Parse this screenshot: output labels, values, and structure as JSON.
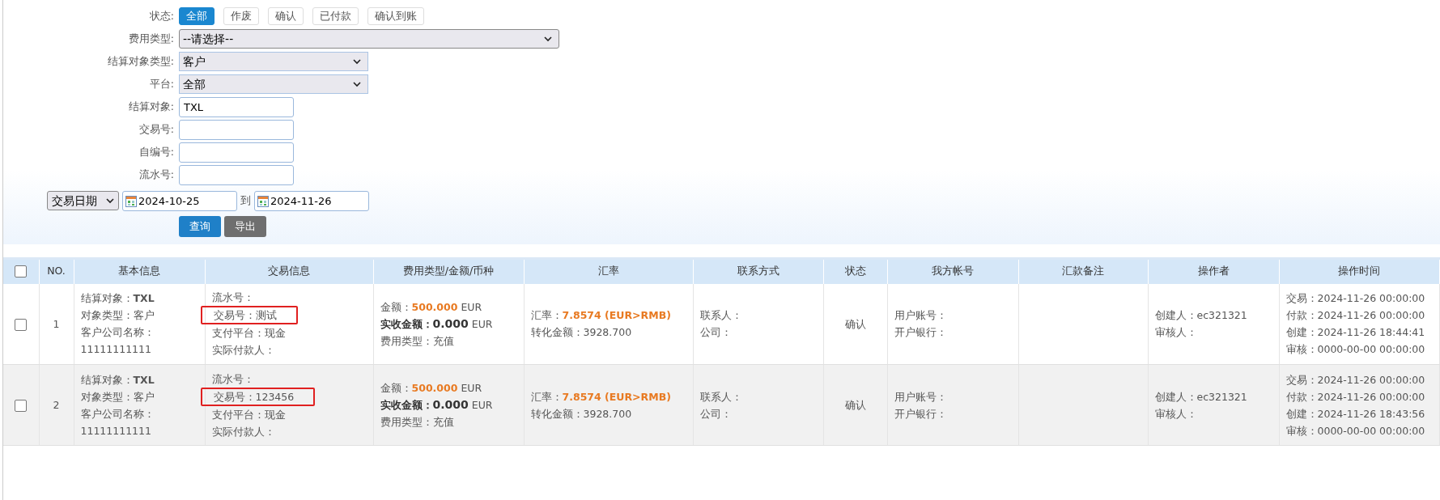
{
  "filters": {
    "status": {
      "label": "状态:",
      "options": [
        {
          "label": "全部",
          "selected": true
        },
        {
          "label": "作废",
          "selected": false
        },
        {
          "label": "确认",
          "selected": false
        },
        {
          "label": "已付款",
          "selected": false
        },
        {
          "label": "确认到账",
          "selected": false
        }
      ]
    },
    "fields": [
      {
        "label": "费用类型:",
        "kind": "wide-select",
        "value": "--请选择--"
      },
      {
        "label": "结算对象类型:",
        "kind": "select",
        "value": "客户"
      },
      {
        "label": "平台:",
        "kind": "select",
        "value": "全部"
      },
      {
        "label": "结算对象:",
        "kind": "input",
        "value": "TXL"
      },
      {
        "label": "交易号:",
        "kind": "input"
      },
      {
        "label": "自编号:",
        "kind": "input"
      },
      {
        "label": "流水号:",
        "kind": "input"
      }
    ],
    "date_range": {
      "type": "交易日期",
      "from": "2024-10-25",
      "separator": "到",
      "to": "2024-11-26"
    },
    "buttons": [
      {
        "label": "查询",
        "kind": "primary"
      },
      {
        "label": "导出",
        "kind": "secondary"
      }
    ]
  },
  "table": {
    "all_checked": false,
    "columns": [
      "NO.",
      "基本信息",
      "交易信息",
      "费用类型/金额/币种",
      "汇率",
      "联系方式",
      "状态",
      "我方帐号",
      "汇款备注",
      "操作者",
      "操作时间"
    ],
    "rows": [
      {
        "checked": false,
        "no": "1",
        "basic": [
          "结算对象：**TXL**",
          "对象类型：客户",
          "客户公司名称：",
          "11111111111"
        ],
        "trade": [
          {
            "text": "流水号：",
            "highlighted": false
          },
          {
            "text": "交易号：测试",
            "highlighted": true
          },
          {
            "text": "支付平台：现金",
            "highlighted": false
          },
          {
            "text": "实际付款人：",
            "highlighted": false
          }
        ],
        "fee": [
          [
            {
              "t": "金额：",
              "kind": "text"
            },
            {
              "t": "500.000",
              "kind": "amount"
            },
            {
              "t": " EUR",
              "kind": "text"
            }
          ],
          [
            {
              "t": "实收金额：",
              "kind": "strong-label"
            },
            {
              "t": "0.000",
              "kind": "strong-amount"
            },
            {
              "t": " EUR",
              "kind": "text"
            }
          ],
          [
            {
              "t": "费用类型：充值",
              "kind": "text"
            }
          ]
        ],
        "rate": [
          [
            {
              "t": "汇率：",
              "kind": "text"
            },
            {
              "t": "7.8574  (EUR>RMB)",
              "kind": "amount"
            }
          ],
          [
            {
              "t": "转化金额：3928.700",
              "kind": "text"
            }
          ]
        ],
        "contact": [
          "联系人：",
          "公司："
        ],
        "status": "确认",
        "account": [
          "用户账号：",
          "开户银行："
        ],
        "operator": [
          "创建人：ec321321",
          "审核人："
        ],
        "times": [
          "交易：2024-11-26 00:00:00",
          "付款：2024-11-26 00:00:00",
          "创建：2024-11-26 18:44:41",
          "审核：0000-00-00 00:00:00"
        ]
      },
      {
        "checked": false,
        "no": "2",
        "basic": [
          "结算对象：**TXL**",
          "对象类型：客户",
          "客户公司名称：",
          "11111111111"
        ],
        "trade": [
          {
            "text": "流水号：",
            "highlighted": false
          },
          {
            "text": "交易号：123456",
            "highlighted": true
          },
          {
            "text": "支付平台：现金",
            "highlighted": false
          },
          {
            "text": "实际付款人：",
            "highlighted": false
          }
        ],
        "fee": [
          [
            {
              "t": "金额：",
              "kind": "text"
            },
            {
              "t": "500.000",
              "kind": "amount"
            },
            {
              "t": " EUR",
              "kind": "text"
            }
          ],
          [
            {
              "t": "实收金额：",
              "kind": "strong-label"
            },
            {
              "t": "0.000",
              "kind": "strong-amount"
            },
            {
              "t": " EUR",
              "kind": "text"
            }
          ],
          [
            {
              "t": "费用类型：充值",
              "kind": "text"
            }
          ]
        ],
        "rate": [
          [
            {
              "t": "汇率：",
              "kind": "text"
            },
            {
              "t": "7.8574  (EUR>RMB)",
              "kind": "amount"
            }
          ],
          [
            {
              "t": "转化金额：3928.700",
              "kind": "text"
            }
          ]
        ],
        "contact": [
          "联系人：",
          "公司："
        ],
        "status": "确认",
        "account": [
          "用户账号：",
          "开户银行："
        ],
        "operator": [
          "创建人：ec321321",
          "审核人："
        ],
        "times": [
          "交易：2024-11-26 00:00:00",
          "付款：2024-11-26 00:00:00",
          "创建：2024-11-26 18:43:56",
          "审核：0000-00-00 00:00:00"
        ]
      }
    ]
  }
}
